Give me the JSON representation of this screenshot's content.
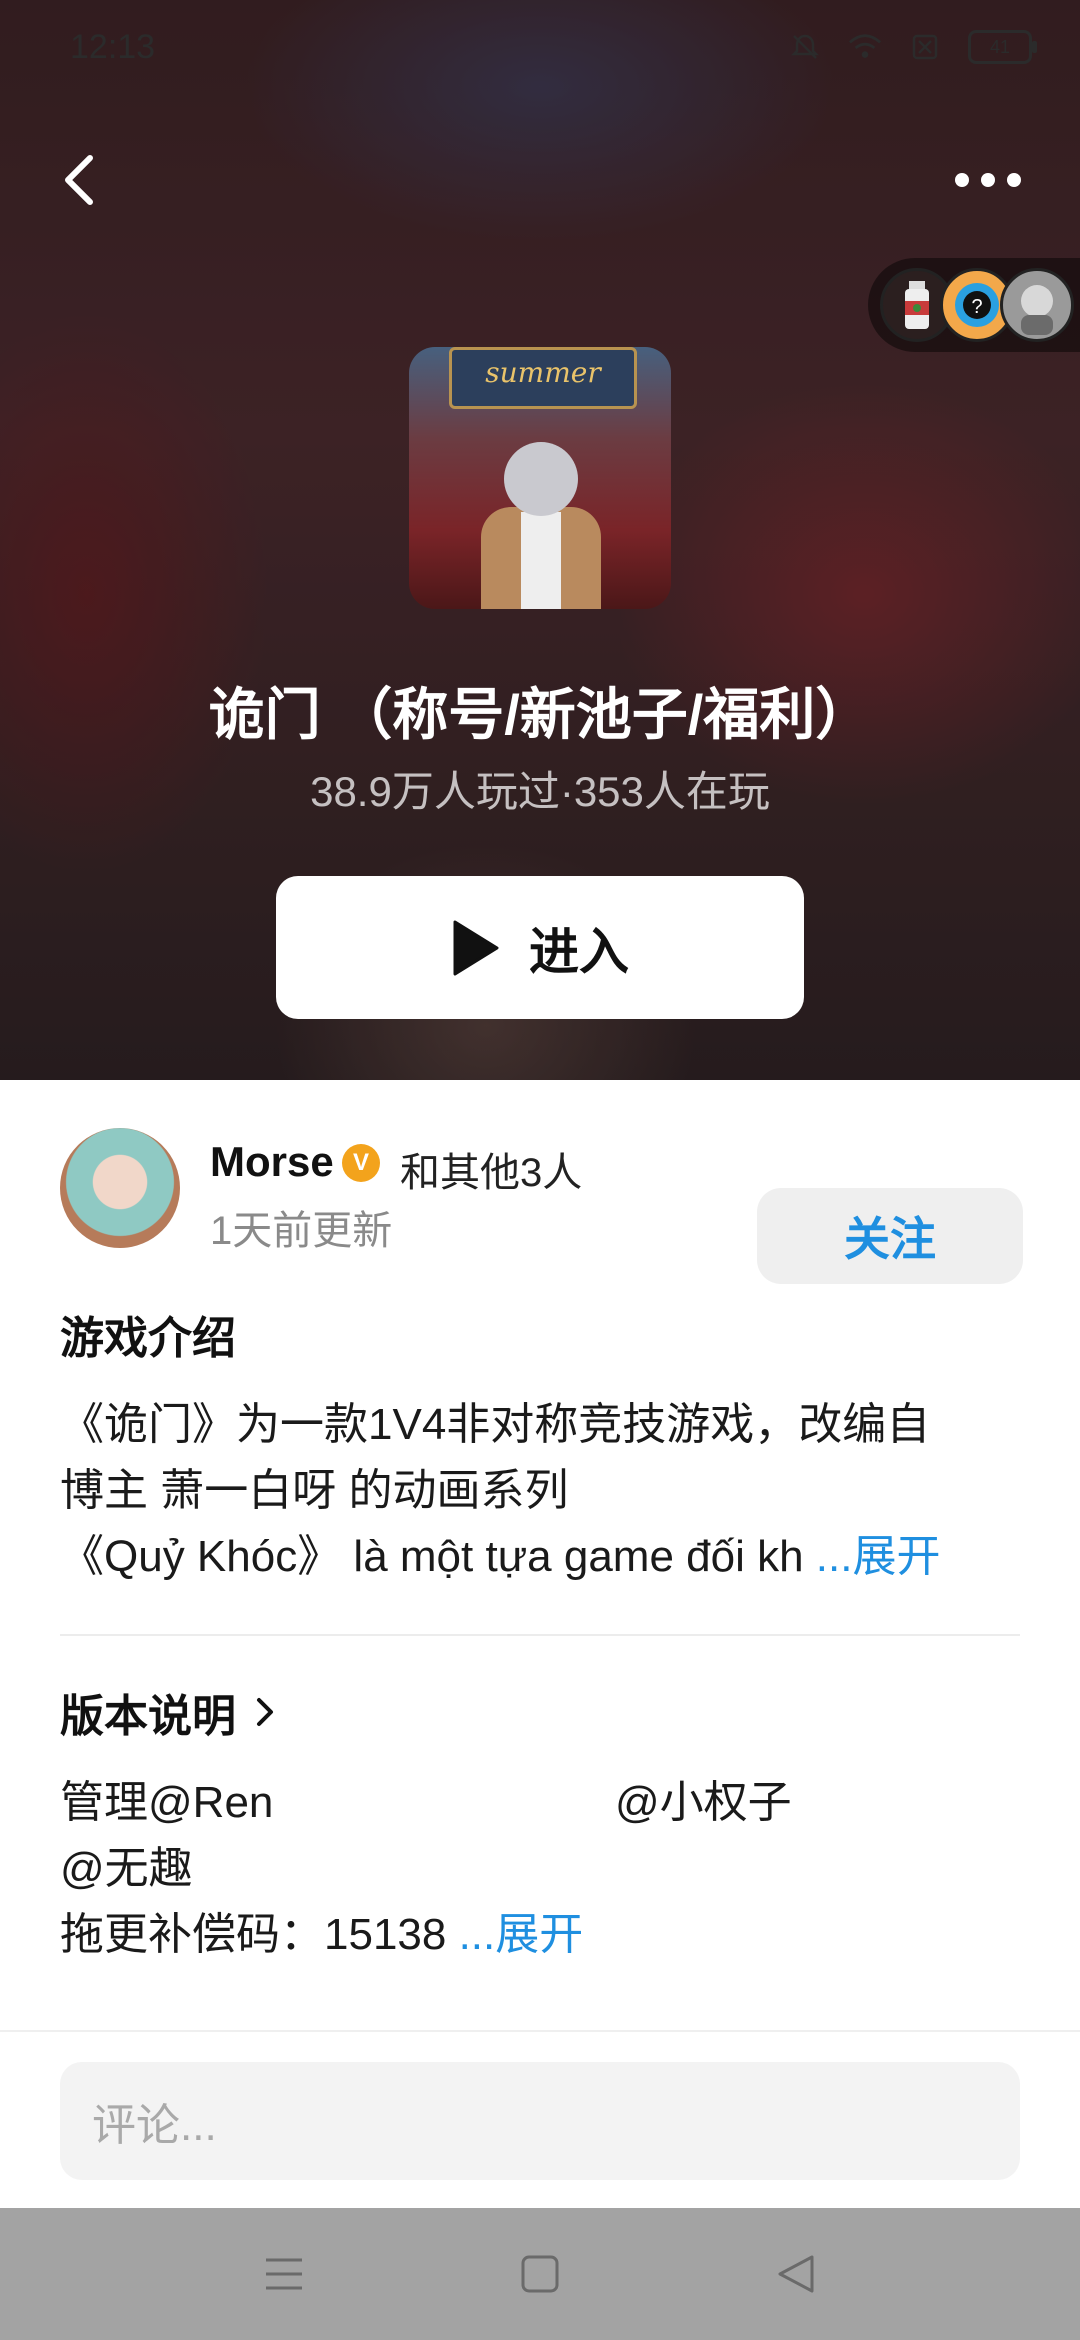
{
  "status_bar": {
    "time": "12:13",
    "battery": "41"
  },
  "game": {
    "cover_banner": "summer",
    "title": "诡门 （称号/新池子/福利）",
    "stats": "38.9万人玩过·353人在玩",
    "enter_label": "进入"
  },
  "author": {
    "name": "Morse",
    "badge": "V",
    "others": "和其他3人",
    "updated": "1天前更新",
    "follow_label": "关注"
  },
  "intro": {
    "heading": "游戏介绍",
    "line1": "《诡门》为一款1V4非对称竞技游戏，改编自",
    "line2": "博主 萧一白呀 的动画系列",
    "line3": "《Quỷ Khóc》 là một tựa game đối kh ",
    "expand": "...展开"
  },
  "version": {
    "heading": "版本说明",
    "line1_a": "管理@Ren",
    "line1_b": "@小权子",
    "line2": "@无趣",
    "line3": "拖更补偿码：15138 ",
    "expand": "...展开"
  },
  "comment": {
    "placeholder": "评论..."
  },
  "colors": {
    "accent": "#1f8fe0",
    "badge": "#f3a31c"
  },
  "icons": [
    "bell-off-icon",
    "wifi-icon",
    "sim-off-icon",
    "battery-icon",
    "back-icon",
    "more-icon",
    "play-icon",
    "chevron-right-icon",
    "menu-icon",
    "home-icon",
    "back-triangle-icon"
  ]
}
